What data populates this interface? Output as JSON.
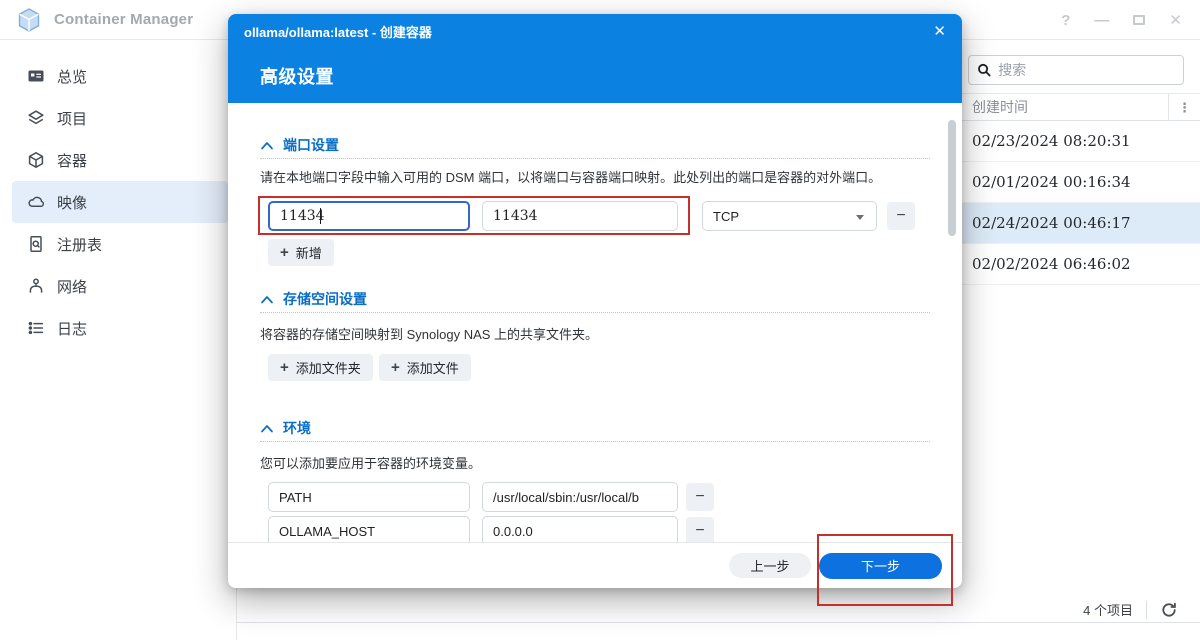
{
  "app": {
    "title": "Container Manager",
    "window": {
      "help": "?",
      "minimize": "—",
      "close": "✕"
    }
  },
  "sidebar": {
    "items": [
      {
        "icon": "overview-icon",
        "label": "总览"
      },
      {
        "icon": "project-icon",
        "label": "项目"
      },
      {
        "icon": "container-icon",
        "label": "容器"
      },
      {
        "icon": "image-icon",
        "label": "映像"
      },
      {
        "icon": "registry-icon",
        "label": "注册表"
      },
      {
        "icon": "network-icon",
        "label": "网络"
      },
      {
        "icon": "log-icon",
        "label": "日志"
      }
    ],
    "active_item": "映像"
  },
  "panel": {
    "search_placeholder": "搜索",
    "column_header": "创建时间",
    "column_menu_glyph": "⋮",
    "rows": [
      "02/23/2024 08:20:31",
      "02/01/2024 00:16:34",
      "02/24/2024 00:46:17",
      "02/02/2024 06:46:02"
    ],
    "selected_row_index": 2,
    "footer_count": "4 个项目"
  },
  "dialog": {
    "title": "ollama/ollama:latest - 创建容器",
    "close_glyph": "✕",
    "heading": "高级设置",
    "glyphs": {
      "plus": "+",
      "minus": "−"
    },
    "ports": {
      "title": "端口设置",
      "description": "请在本地端口字段中输入可用的 DSM 端口，以将端口与容器端口映射。此处列出的端口是容器的对外端口。",
      "local_port": "11434",
      "container_port": "11434",
      "protocol": "TCP",
      "add_label": "新增"
    },
    "storage": {
      "title": "存储空间设置",
      "description": "将容器的存储空间映射到 Synology NAS 上的共享文件夹。",
      "add_folder_label": "添加文件夹",
      "add_file_label": "添加文件"
    },
    "env": {
      "title": "环境",
      "description": "您可以添加要应用于容器的环境变量。",
      "vars": [
        {
          "name": "PATH",
          "value": "/usr/local/sbin:/usr/local/b"
        },
        {
          "name": "OLLAMA_HOST",
          "value": "0.0.0.0"
        }
      ]
    },
    "footer": {
      "back_label": "上一步",
      "next_label": "下一步"
    }
  },
  "colors": {
    "accent_blue": "#0b82e2",
    "section_blue": "#0a6ec6",
    "annotation_red": "#c4302b",
    "selected_row": "#ddebf8"
  }
}
